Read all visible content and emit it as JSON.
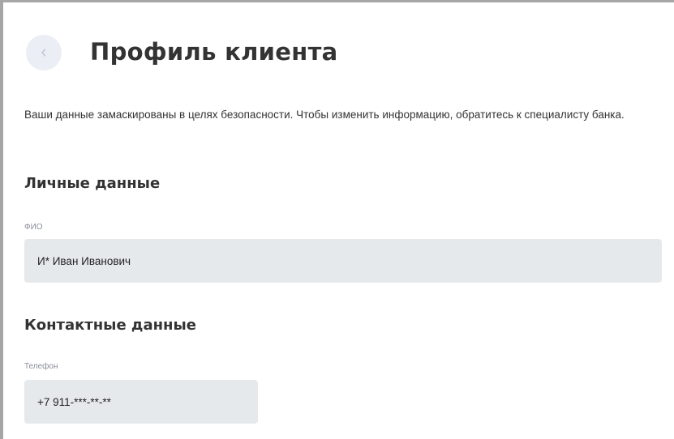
{
  "header": {
    "title": "Профиль клиента",
    "back_icon": "chevron-left-icon"
  },
  "notice": "Ваши данные замаскированы в целях безопасности. Чтобы изменить информацию, обратитесь к специалисту банка.",
  "sections": {
    "personal": {
      "title": "Личные данные",
      "fio_label": "ФИО",
      "fio_value": "И* Иван Иванович"
    },
    "contacts": {
      "title": "Контактные данные",
      "phone_label": "Телефон",
      "phone_value": "+7 911-***-**-**"
    }
  },
  "colors": {
    "field_background": "#e6e9ec",
    "back_button_background": "#eceef6",
    "title_text": "#333333"
  }
}
